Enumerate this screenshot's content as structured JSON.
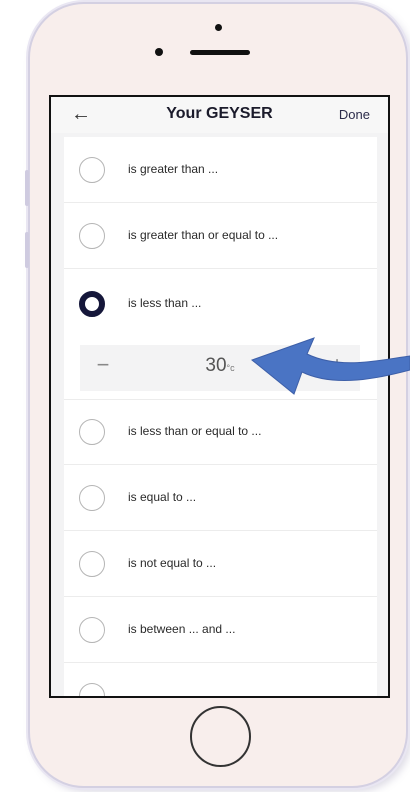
{
  "header": {
    "back_icon": "arrow-left-icon",
    "title": "Your GEYSER",
    "done_label": "Done"
  },
  "options": [
    {
      "label": "is greater than ...",
      "selected": false
    },
    {
      "label": "is greater than or equal to ...",
      "selected": false
    },
    {
      "label": "is less than ...",
      "selected": true
    },
    {
      "label": "is less than or equal to ...",
      "selected": false
    },
    {
      "label": "is equal to ...",
      "selected": false
    },
    {
      "label": "is not equal to ...",
      "selected": false
    },
    {
      "label": "is between ... and ...",
      "selected": false
    }
  ],
  "stepper": {
    "value": "30",
    "unit": "°c",
    "minus_icon": "minus-icon",
    "plus_icon": "plus-icon"
  },
  "colors": {
    "accent": "#15173a",
    "annotation_arrow": "#4a74c4"
  }
}
